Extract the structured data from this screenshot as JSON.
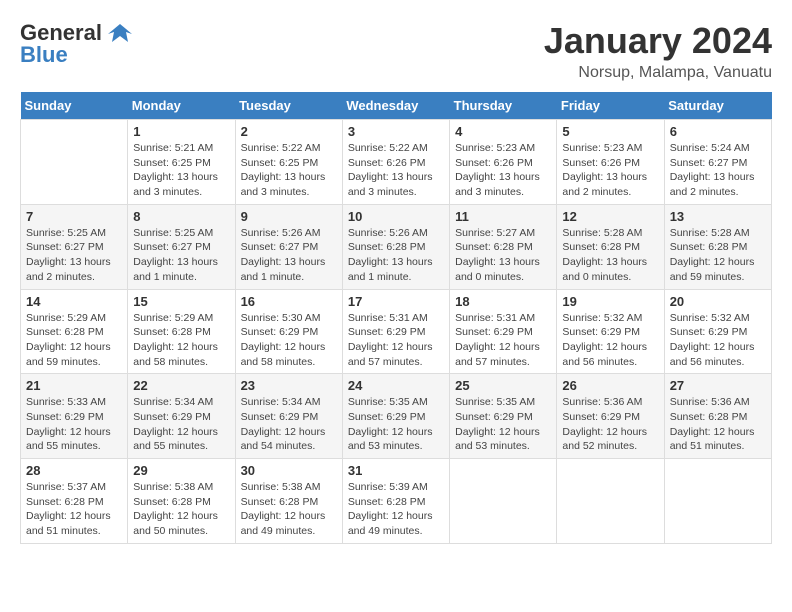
{
  "header": {
    "logo_general": "General",
    "logo_blue": "Blue",
    "title": "January 2024",
    "subtitle": "Norsup, Malampa, Vanuatu"
  },
  "weekdays": [
    "Sunday",
    "Monday",
    "Tuesday",
    "Wednesday",
    "Thursday",
    "Friday",
    "Saturday"
  ],
  "weeks": [
    [
      {
        "day": "",
        "info": ""
      },
      {
        "day": "1",
        "info": "Sunrise: 5:21 AM\nSunset: 6:25 PM\nDaylight: 13 hours\nand 3 minutes."
      },
      {
        "day": "2",
        "info": "Sunrise: 5:22 AM\nSunset: 6:25 PM\nDaylight: 13 hours\nand 3 minutes."
      },
      {
        "day": "3",
        "info": "Sunrise: 5:22 AM\nSunset: 6:26 PM\nDaylight: 13 hours\nand 3 minutes."
      },
      {
        "day": "4",
        "info": "Sunrise: 5:23 AM\nSunset: 6:26 PM\nDaylight: 13 hours\nand 3 minutes."
      },
      {
        "day": "5",
        "info": "Sunrise: 5:23 AM\nSunset: 6:26 PM\nDaylight: 13 hours\nand 2 minutes."
      },
      {
        "day": "6",
        "info": "Sunrise: 5:24 AM\nSunset: 6:27 PM\nDaylight: 13 hours\nand 2 minutes."
      }
    ],
    [
      {
        "day": "7",
        "info": "Sunrise: 5:25 AM\nSunset: 6:27 PM\nDaylight: 13 hours\nand 2 minutes."
      },
      {
        "day": "8",
        "info": "Sunrise: 5:25 AM\nSunset: 6:27 PM\nDaylight: 13 hours\nand 1 minute."
      },
      {
        "day": "9",
        "info": "Sunrise: 5:26 AM\nSunset: 6:27 PM\nDaylight: 13 hours\nand 1 minute."
      },
      {
        "day": "10",
        "info": "Sunrise: 5:26 AM\nSunset: 6:28 PM\nDaylight: 13 hours\nand 1 minute."
      },
      {
        "day": "11",
        "info": "Sunrise: 5:27 AM\nSunset: 6:28 PM\nDaylight: 13 hours\nand 0 minutes."
      },
      {
        "day": "12",
        "info": "Sunrise: 5:28 AM\nSunset: 6:28 PM\nDaylight: 13 hours\nand 0 minutes."
      },
      {
        "day": "13",
        "info": "Sunrise: 5:28 AM\nSunset: 6:28 PM\nDaylight: 12 hours\nand 59 minutes."
      }
    ],
    [
      {
        "day": "14",
        "info": "Sunrise: 5:29 AM\nSunset: 6:28 PM\nDaylight: 12 hours\nand 59 minutes."
      },
      {
        "day": "15",
        "info": "Sunrise: 5:29 AM\nSunset: 6:28 PM\nDaylight: 12 hours\nand 58 minutes."
      },
      {
        "day": "16",
        "info": "Sunrise: 5:30 AM\nSunset: 6:29 PM\nDaylight: 12 hours\nand 58 minutes."
      },
      {
        "day": "17",
        "info": "Sunrise: 5:31 AM\nSunset: 6:29 PM\nDaylight: 12 hours\nand 57 minutes."
      },
      {
        "day": "18",
        "info": "Sunrise: 5:31 AM\nSunset: 6:29 PM\nDaylight: 12 hours\nand 57 minutes."
      },
      {
        "day": "19",
        "info": "Sunrise: 5:32 AM\nSunset: 6:29 PM\nDaylight: 12 hours\nand 56 minutes."
      },
      {
        "day": "20",
        "info": "Sunrise: 5:32 AM\nSunset: 6:29 PM\nDaylight: 12 hours\nand 56 minutes."
      }
    ],
    [
      {
        "day": "21",
        "info": "Sunrise: 5:33 AM\nSunset: 6:29 PM\nDaylight: 12 hours\nand 55 minutes."
      },
      {
        "day": "22",
        "info": "Sunrise: 5:34 AM\nSunset: 6:29 PM\nDaylight: 12 hours\nand 55 minutes."
      },
      {
        "day": "23",
        "info": "Sunrise: 5:34 AM\nSunset: 6:29 PM\nDaylight: 12 hours\nand 54 minutes."
      },
      {
        "day": "24",
        "info": "Sunrise: 5:35 AM\nSunset: 6:29 PM\nDaylight: 12 hours\nand 53 minutes."
      },
      {
        "day": "25",
        "info": "Sunrise: 5:35 AM\nSunset: 6:29 PM\nDaylight: 12 hours\nand 53 minutes."
      },
      {
        "day": "26",
        "info": "Sunrise: 5:36 AM\nSunset: 6:29 PM\nDaylight: 12 hours\nand 52 minutes."
      },
      {
        "day": "27",
        "info": "Sunrise: 5:36 AM\nSunset: 6:28 PM\nDaylight: 12 hours\nand 51 minutes."
      }
    ],
    [
      {
        "day": "28",
        "info": "Sunrise: 5:37 AM\nSunset: 6:28 PM\nDaylight: 12 hours\nand 51 minutes."
      },
      {
        "day": "29",
        "info": "Sunrise: 5:38 AM\nSunset: 6:28 PM\nDaylight: 12 hours\nand 50 minutes."
      },
      {
        "day": "30",
        "info": "Sunrise: 5:38 AM\nSunset: 6:28 PM\nDaylight: 12 hours\nand 49 minutes."
      },
      {
        "day": "31",
        "info": "Sunrise: 5:39 AM\nSunset: 6:28 PM\nDaylight: 12 hours\nand 49 minutes."
      },
      {
        "day": "",
        "info": ""
      },
      {
        "day": "",
        "info": ""
      },
      {
        "day": "",
        "info": ""
      }
    ]
  ]
}
